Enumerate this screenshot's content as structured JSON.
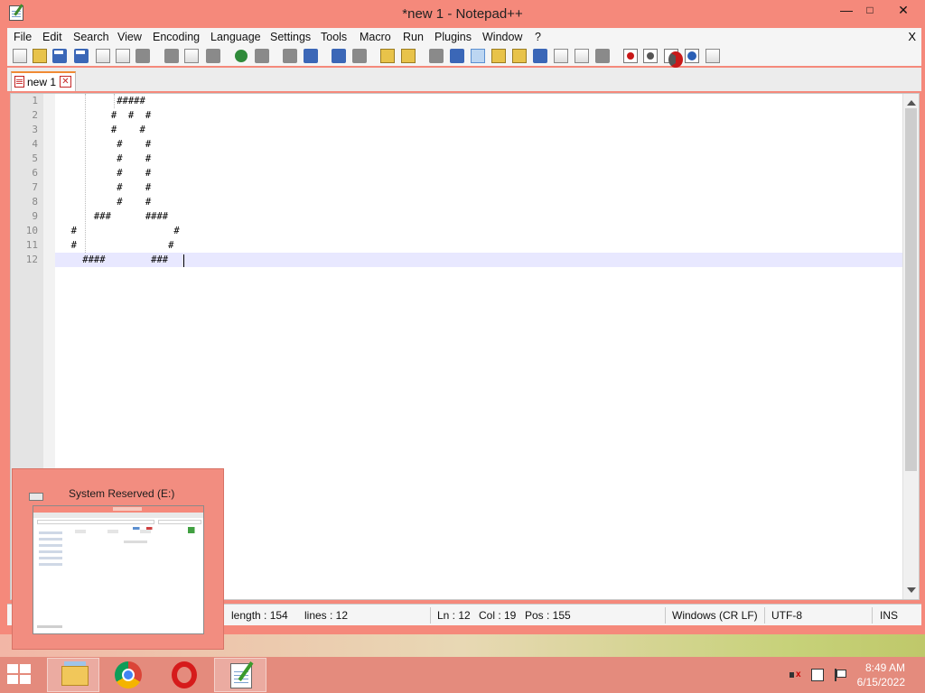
{
  "window": {
    "title": "*new 1 - Notepad++",
    "min_symbol": "—",
    "max_symbol": "□",
    "close_symbol": "✕"
  },
  "menu": {
    "items": [
      "File",
      "Edit",
      "Search",
      "View",
      "Encoding",
      "Language",
      "Settings",
      "Tools",
      "Macro",
      "Run",
      "Plugins",
      "Window",
      "?"
    ],
    "close_symbol": "X"
  },
  "toolbar": {
    "icons": [
      "new-file-icon",
      "open-file-icon",
      "save-icon",
      "save-all-icon",
      "close-icon",
      "close-all-icon",
      "print-icon",
      "cut-icon",
      "copy-icon",
      "paste-icon",
      "undo-icon",
      "redo-icon",
      "find-icon",
      "replace-icon",
      "zoom-in-icon",
      "zoom-out-icon",
      "sync-vertical-icon",
      "sync-horizontal-icon",
      "word-wrap-icon",
      "show-all-chars-icon",
      "indent-guide-icon",
      "user-defined-language-icon",
      "document-map-icon",
      "function-list-icon",
      "folder-as-workspace-icon",
      "monitoring-icon",
      "record-macro-icon",
      "stop-record-icon",
      "playback-icon",
      "run-macro-multiple-icon",
      "save-macro-icon"
    ]
  },
  "tab": {
    "label": "new 1",
    "close_symbol": "✕"
  },
  "editor": {
    "line_numbers": [
      "1",
      "2",
      "3",
      "4",
      "5",
      "6",
      "7",
      "8",
      "9",
      "10",
      "11",
      "12"
    ],
    "lines": [
      "          #####",
      "         #  #  #",
      "         #    #",
      "          #    #",
      "          #    #",
      "          #    #",
      "          #    #",
      "          #    #",
      "      ###      ####",
      "  #                 #",
      "  #                #",
      "    ####        ###"
    ],
    "current_line": 12
  },
  "status": {
    "length": "length : 154",
    "lines": "lines : 12",
    "ln": "Ln : 12",
    "col": "Col : 19",
    "pos": "Pos : 155",
    "eol": "Windows (CR LF)",
    "encoding": "UTF-8",
    "mode": "INS"
  },
  "preview": {
    "title": "System Reserved (E:)"
  },
  "taskbar": {
    "apps": [
      "file-explorer",
      "google-chrome",
      "opera",
      "notepad-plus-plus"
    ],
    "active_app": "notepad-plus-plus"
  },
  "tray": {
    "time": "8:49 AM",
    "date": "6/15/2022"
  },
  "colors": {
    "accent": "#f5897b",
    "taskbar": "#e48b7d",
    "current_line_highlight": "#e8e8ff"
  }
}
